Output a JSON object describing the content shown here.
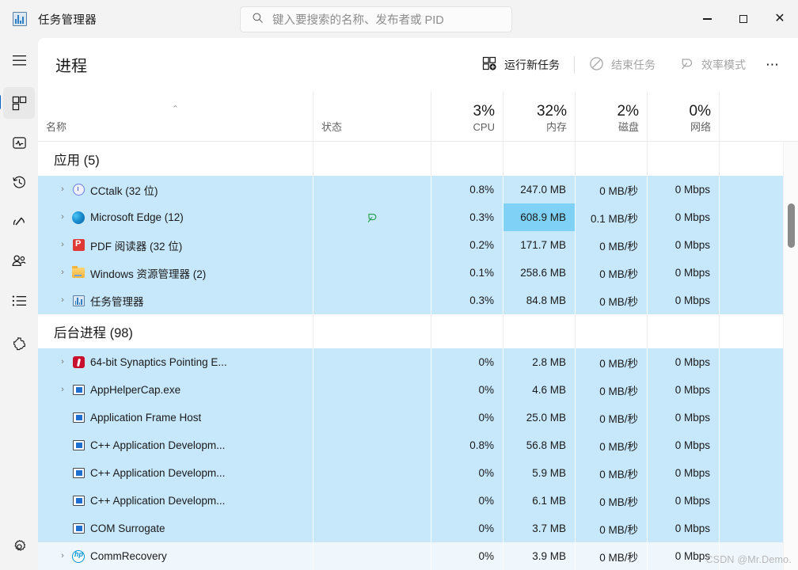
{
  "window": {
    "title": "任务管理器",
    "app_icon": "task-manager-icon",
    "minimize": "−",
    "maximize": "□",
    "close": "✕"
  },
  "search": {
    "placeholder": "键入要搜索的名称、发布者或 PID",
    "value": "",
    "icon": "search-icon"
  },
  "sidebar": {
    "hamburger_label": "☰",
    "items": [
      {
        "name": "processes",
        "icon": "processes-icon",
        "selected": true
      },
      {
        "name": "performance",
        "icon": "performance-icon",
        "selected": false
      },
      {
        "name": "app-history",
        "icon": "app-history-icon",
        "selected": false
      },
      {
        "name": "startup-apps",
        "icon": "startup-apps-icon",
        "selected": false
      },
      {
        "name": "users",
        "icon": "users-icon",
        "selected": false
      },
      {
        "name": "details",
        "icon": "details-icon",
        "selected": false
      },
      {
        "name": "services",
        "icon": "services-icon",
        "selected": false
      }
    ],
    "settings": {
      "name": "settings",
      "icon": "gear-icon"
    }
  },
  "page": {
    "title": "进程"
  },
  "toolbar": {
    "run_new_task": {
      "label": "运行新任务",
      "icon": "new-task-icon",
      "enabled": true
    },
    "end_task": {
      "label": "结束任务",
      "icon": "end-task-icon",
      "enabled": false
    },
    "efficiency_mode": {
      "label": "效率模式",
      "icon": "leaf-icon",
      "enabled": false
    },
    "more": {
      "label": "⋯",
      "icon": "more-icon"
    }
  },
  "table": {
    "columns": [
      {
        "key": "name",
        "label": "名称",
        "value": "",
        "sorted": "asc",
        "sort_glyph": "⌃"
      },
      {
        "key": "status",
        "label": "状态",
        "value": ""
      },
      {
        "key": "cpu",
        "label": "CPU",
        "value": "3%"
      },
      {
        "key": "memory",
        "label": "内存",
        "value": "32%"
      },
      {
        "key": "disk",
        "label": "磁盘",
        "value": "2%"
      },
      {
        "key": "network",
        "label": "网络",
        "value": "0%"
      }
    ],
    "groups": [
      {
        "title": "应用 (5)"
      },
      {
        "title": "后台进程 (98)"
      }
    ],
    "rows": [
      {
        "type": "group",
        "name": "应用 (5)"
      },
      {
        "type": "process",
        "expandable": true,
        "icon": "cctalk-icon",
        "name": "CCtalk (32 位)",
        "status": "",
        "cpu": "0.8%",
        "memory": "247.0 MB",
        "disk": "0 MB/秒",
        "network": "0 Mbps",
        "memory_highlight": false
      },
      {
        "type": "process",
        "expandable": true,
        "icon": "edge-icon",
        "name": "Microsoft Edge (12)",
        "status": "efficiency-leaf",
        "cpu": "0.3%",
        "memory": "608.9 MB",
        "disk": "0.1 MB/秒",
        "network": "0 Mbps",
        "memory_highlight": true
      },
      {
        "type": "process",
        "expandable": true,
        "icon": "pdf-icon",
        "name": "PDF 阅读器 (32 位)",
        "status": "",
        "cpu": "0.2%",
        "memory": "171.7 MB",
        "disk": "0 MB/秒",
        "network": "0 Mbps",
        "memory_highlight": false
      },
      {
        "type": "process",
        "expandable": true,
        "icon": "folder-icon",
        "name": "Windows 资源管理器 (2)",
        "status": "",
        "cpu": "0.1%",
        "memory": "258.6 MB",
        "disk": "0 MB/秒",
        "network": "0 Mbps",
        "memory_highlight": false
      },
      {
        "type": "process",
        "expandable": true,
        "icon": "task-manager-icon",
        "name": "任务管理器",
        "status": "",
        "cpu": "0.3%",
        "memory": "84.8 MB",
        "disk": "0 MB/秒",
        "network": "0 Mbps",
        "memory_highlight": false
      },
      {
        "type": "group",
        "name": "后台进程 (98)"
      },
      {
        "type": "process",
        "expandable": true,
        "icon": "synaptics-icon",
        "name": "64-bit Synaptics Pointing E...",
        "status": "",
        "cpu": "0%",
        "memory": "2.8 MB",
        "disk": "0 MB/秒",
        "network": "0 Mbps",
        "memory_highlight": false
      },
      {
        "type": "process",
        "expandable": true,
        "icon": "generic-app-icon",
        "name": "AppHelperCap.exe",
        "status": "",
        "cpu": "0%",
        "memory": "4.6 MB",
        "disk": "0 MB/秒",
        "network": "0 Mbps",
        "memory_highlight": false
      },
      {
        "type": "process",
        "expandable": false,
        "icon": "generic-app-icon",
        "name": "Application Frame Host",
        "status": "",
        "cpu": "0%",
        "memory": "25.0 MB",
        "disk": "0 MB/秒",
        "network": "0 Mbps",
        "memory_highlight": false
      },
      {
        "type": "process",
        "expandable": false,
        "icon": "generic-app-icon",
        "name": "C++ Application Developm...",
        "status": "",
        "cpu": "0.8%",
        "memory": "56.8 MB",
        "disk": "0 MB/秒",
        "network": "0 Mbps",
        "memory_highlight": false
      },
      {
        "type": "process",
        "expandable": false,
        "icon": "generic-app-icon",
        "name": "C++ Application Developm...",
        "status": "",
        "cpu": "0%",
        "memory": "5.9 MB",
        "disk": "0 MB/秒",
        "network": "0 Mbps",
        "memory_highlight": false
      },
      {
        "type": "process",
        "expandable": false,
        "icon": "generic-app-icon",
        "name": "C++ Application Developm...",
        "status": "",
        "cpu": "0%",
        "memory": "6.1 MB",
        "disk": "0 MB/秒",
        "network": "0 Mbps",
        "memory_highlight": false
      },
      {
        "type": "process",
        "expandable": false,
        "icon": "generic-app-icon",
        "name": "COM Surrogate",
        "status": "",
        "cpu": "0%",
        "memory": "3.7 MB",
        "disk": "0 MB/秒",
        "network": "0 Mbps",
        "memory_highlight": false
      },
      {
        "type": "process",
        "expandable": true,
        "icon": "hp-icon",
        "name": "CommRecovery",
        "status": "",
        "cpu": "0%",
        "memory": "3.9 MB",
        "disk": "0 MB/秒",
        "network": "0 Mbps",
        "memory_highlight": false,
        "hovered": true
      }
    ],
    "expand_glyph": "›"
  },
  "colors": {
    "row_heat": "#c7e7fb",
    "cell_highlight": "#7fd2f6",
    "accent": "#0a64c8",
    "panel": "#ffffff",
    "chrome": "#f3f3f3"
  },
  "watermark": "CSDN @Mr.Demo."
}
